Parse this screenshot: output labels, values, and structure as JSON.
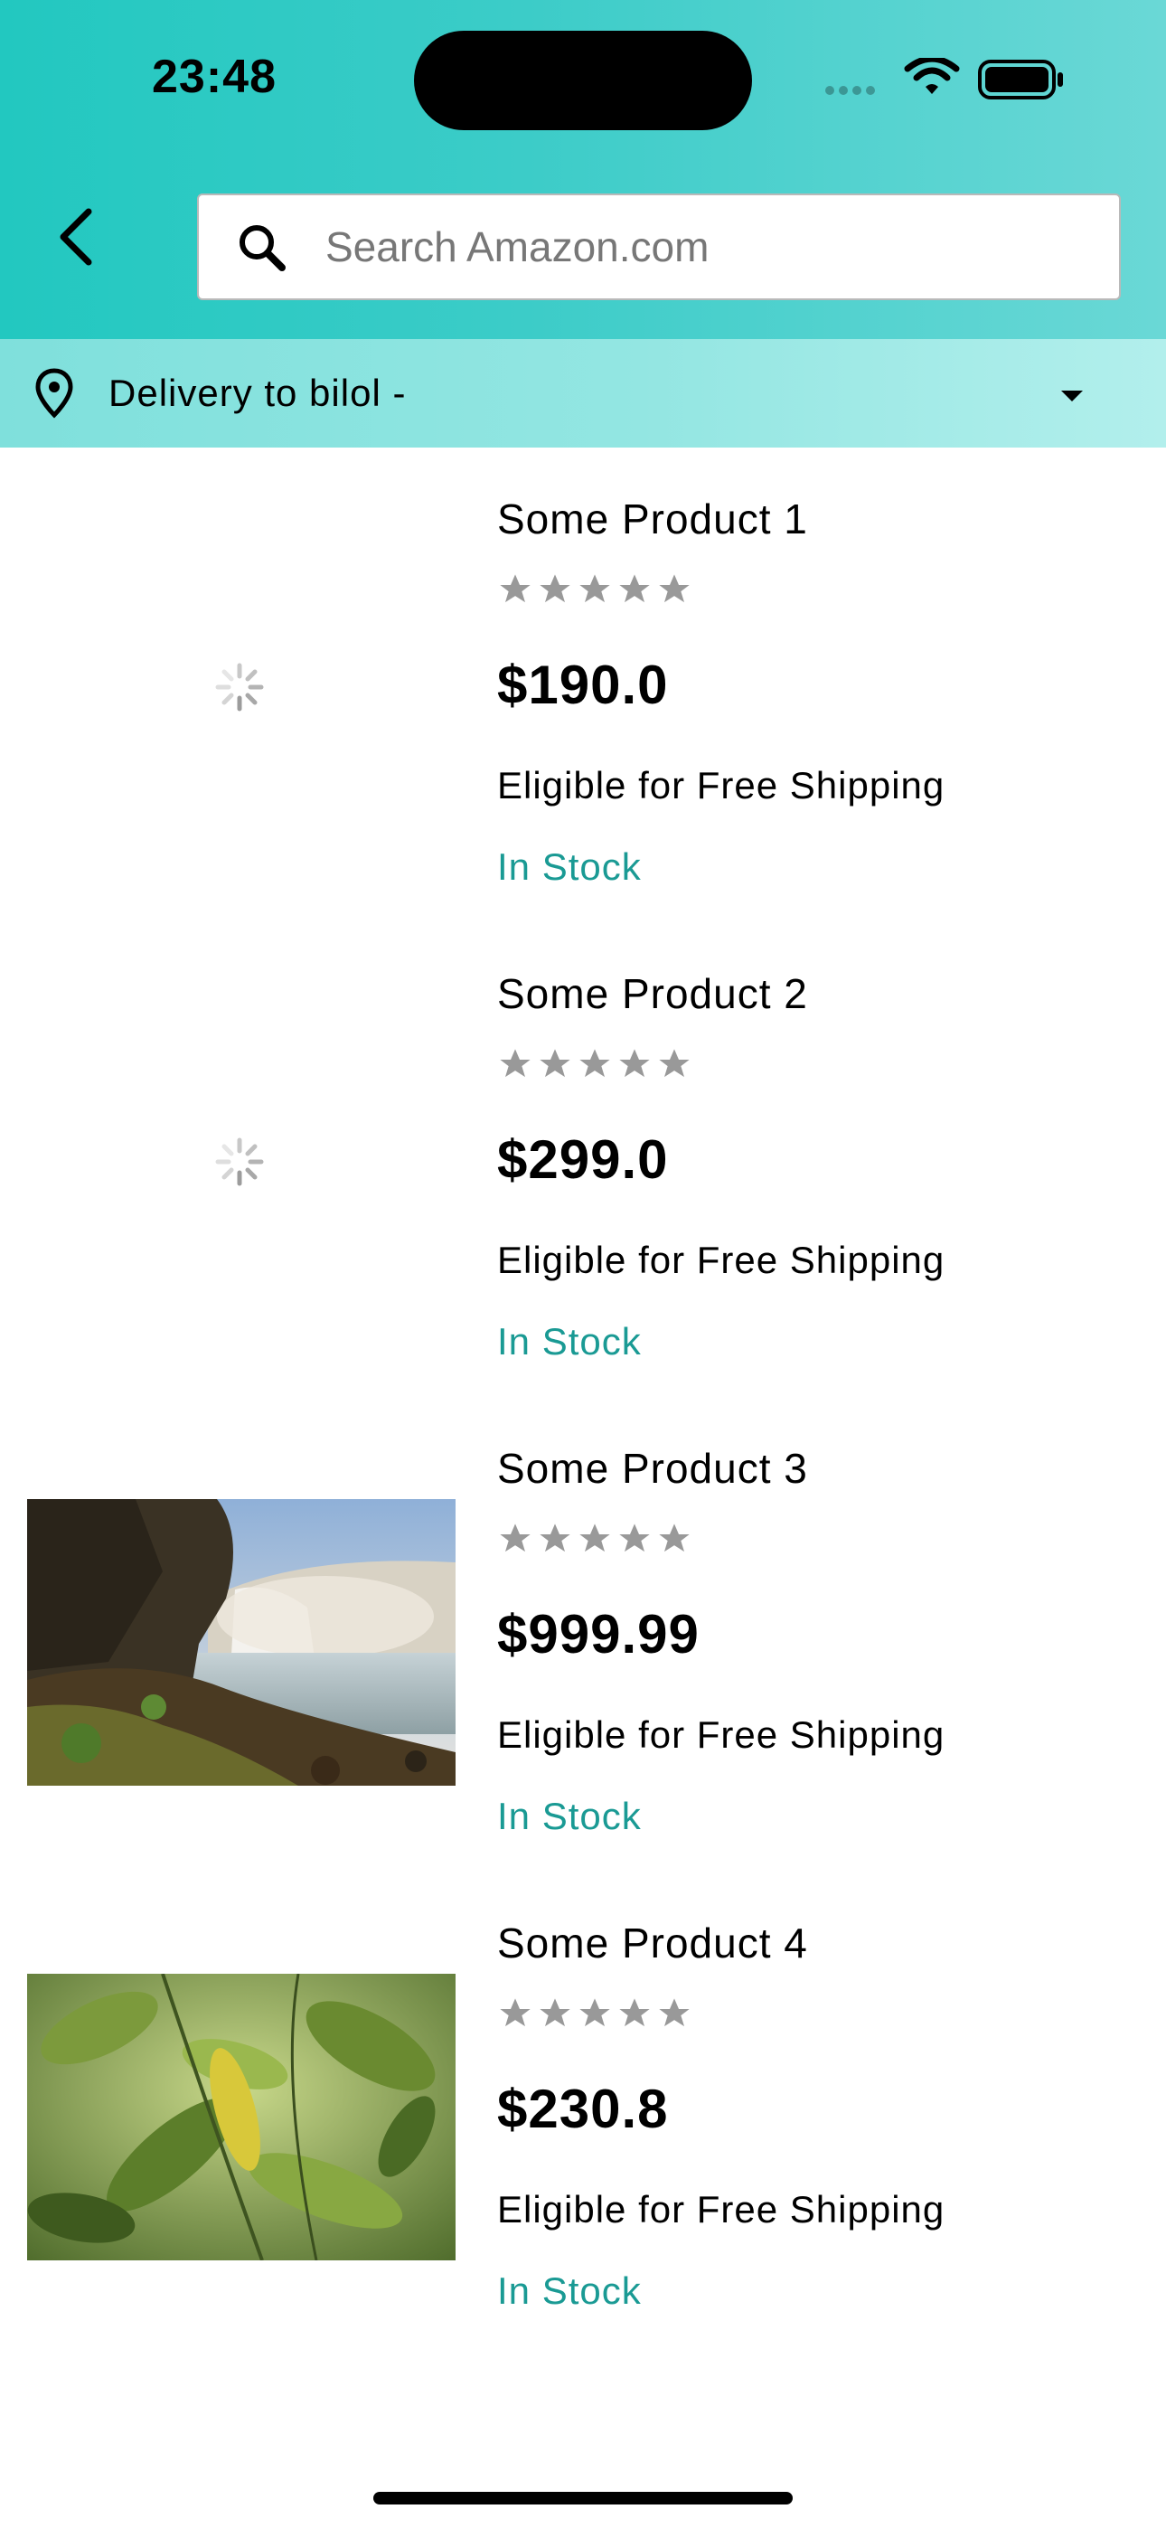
{
  "status_bar": {
    "time": "23:48"
  },
  "header": {
    "back_icon": "chevron-left-icon",
    "search": {
      "placeholder": "Search Amazon.com",
      "value": "",
      "icon": "search-icon"
    }
  },
  "delivery": {
    "text": "Delivery to bilol -",
    "icon": "location-pin-icon",
    "dropdown_icon": "caret-down-icon"
  },
  "products": [
    {
      "name": "Some Product 1",
      "price": "$190.0",
      "rating_stars": 5,
      "shipping": "Eligible for Free Shipping",
      "stock": "In Stock",
      "image": "loading"
    },
    {
      "name": "Some Product 2",
      "price": "$299.0",
      "rating_stars": 5,
      "shipping": "Eligible for Free Shipping",
      "stock": "In Stock",
      "image": "loading"
    },
    {
      "name": "Some Product 3",
      "price": "$999.99",
      "rating_stars": 5,
      "shipping": "Eligible for Free Shipping",
      "stock": "In Stock",
      "image": "waterfall-photo"
    },
    {
      "name": "Some Product 4",
      "price": "$230.8",
      "rating_stars": 5,
      "shipping": "Eligible for Free Shipping",
      "stock": "In Stock",
      "image": "green-leaves-photo"
    }
  ],
  "colors": {
    "header_start": "#22c8c0",
    "header_end": "#6ad8d6",
    "delivery_bar": "#93e6e2",
    "in_stock": "#1a9a94",
    "star": "#999999"
  }
}
